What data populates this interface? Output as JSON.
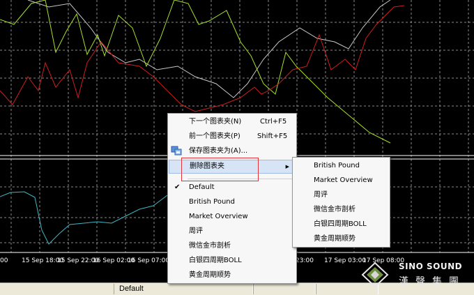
{
  "time_axis": [
    "00",
    "15 Sep 18:00",
    "15 Sep 22:00",
    "16 Sep 02:00",
    "16 Sep 07:00",
    "23:00",
    "17 Sep 03:00",
    "17 Sep 08:00"
  ],
  "status_bar": {
    "profile": "Default"
  },
  "context_menu": {
    "items": [
      {
        "label": "下一个图表夹(N)",
        "shortcut": "Ctrl+F5"
      },
      {
        "label": "前一个图表夹(P)",
        "shortcut": "Shift+F5"
      },
      {
        "label": "保存图表夹为(A)...",
        "icon": "save-profile-icon"
      },
      {
        "label": "删除图表夹",
        "has_submenu": true,
        "highlighted": true
      },
      {
        "label": "Default",
        "checked": true
      },
      {
        "label": "British Pound"
      },
      {
        "label": "Market Overview"
      },
      {
        "label": "周评"
      },
      {
        "label": "微信金市剖析"
      },
      {
        "label": "白银四周期BOLL"
      },
      {
        "label": "黄金周期顺势"
      }
    ]
  },
  "submenu": {
    "items": [
      "British Pound",
      "Market Overview",
      "周评",
      "微信金市剖析",
      "白银四周期BOLL",
      "黄金周期顺势"
    ]
  },
  "watermark": {
    "brand_en": "SINO SOUND",
    "brand_cn": "漢聲集團"
  },
  "colors": {
    "background": "#000000",
    "grid": "#8a8a8a",
    "series_red": "#cc1f1f",
    "series_green": "#a8e02a",
    "series_gray": "#c8c8c8",
    "series_cyan": "#3fb7c4",
    "menu_highlight": "#d6e4f5",
    "annotation_box": "#e0353a"
  }
}
